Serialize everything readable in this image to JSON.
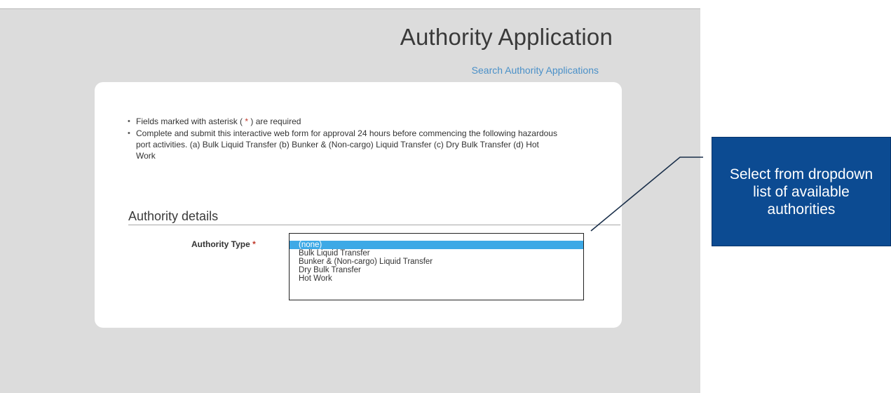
{
  "header": {
    "title": "Authority Application",
    "search_link": "Search Authority Applications"
  },
  "instructions": [
    {
      "parts": [
        "Fields marked with asterisk ( ",
        "*",
        " ) are required"
      ]
    },
    {
      "text": "Complete and submit this interactive web form for approval 24 hours before commencing the following hazardous port activities. (a) Bulk Liquid Transfer (b) Bunker & (Non-cargo) Liquid Transfer (c) Dry Bulk Transfer (d) Hot Work"
    }
  ],
  "section": {
    "title": "Authority details"
  },
  "authority_type": {
    "label": "Authority Type",
    "required_mark": "*",
    "options": [
      "(none)",
      "Bulk Liquid Transfer",
      "Bunker & (Non-cargo) Liquid Transfer",
      "Dry Bulk Transfer",
      "Hot Work"
    ],
    "selected": "(none)"
  },
  "callout": {
    "text": "Select from dropdown list of available authorities",
    "color": "#0c4b92"
  },
  "colors": {
    "accent_link": "#4a90c8",
    "selected_option": "#3da9e6",
    "required": "#c0392b"
  }
}
